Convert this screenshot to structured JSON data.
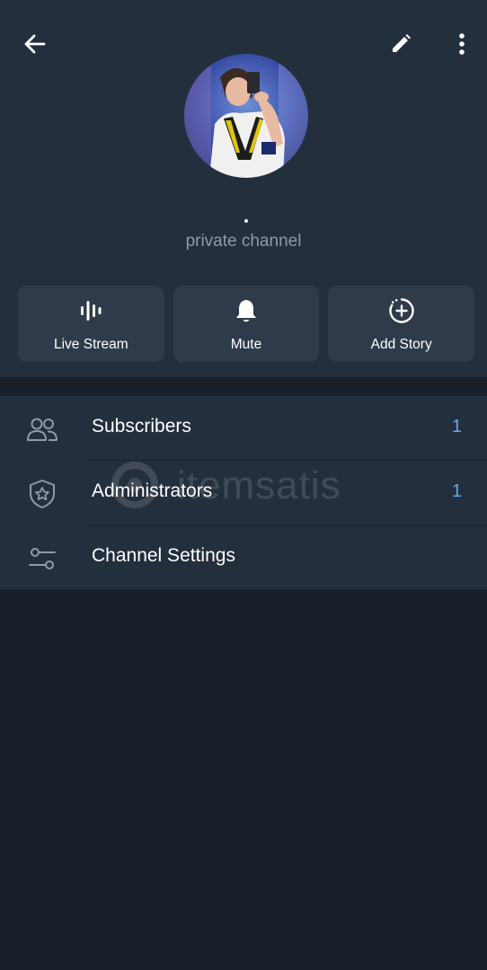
{
  "topbar": {
    "back_icon": "arrow-left-icon",
    "edit_icon": "pencil-icon",
    "more_icon": "more-vertical-icon"
  },
  "profile": {
    "subtitle": "private channel"
  },
  "actions": [
    {
      "label": "Live Stream",
      "icon": "live-stream-icon"
    },
    {
      "label": "Mute",
      "icon": "bell-icon"
    },
    {
      "label": "Add Story",
      "icon": "add-story-icon"
    }
  ],
  "list": {
    "items": [
      {
        "label": "Subscribers",
        "count": "1",
        "icon": "users-icon"
      },
      {
        "label": "Administrators",
        "count": "1",
        "icon": "shield-star-icon"
      },
      {
        "label": "Channel Settings",
        "count": "",
        "icon": "sliders-icon"
      }
    ]
  },
  "watermark": {
    "text": "itemsatis"
  },
  "colors": {
    "header_bg": "#242f3d",
    "page_bg": "#18202a",
    "button_bg": "#2f3b4a",
    "accent": "#63a8e5",
    "muted_text": "#8e9aa8"
  }
}
